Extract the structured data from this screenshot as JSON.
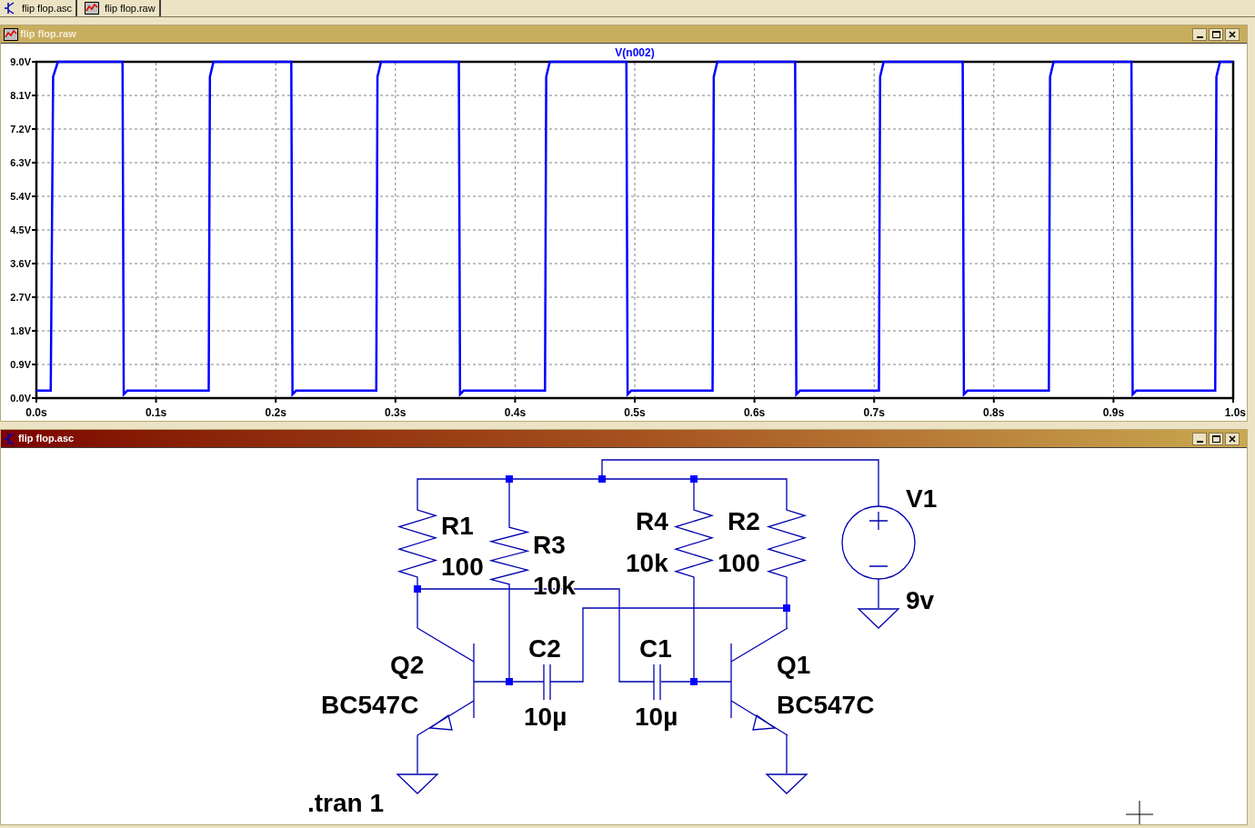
{
  "tabs": [
    {
      "label": "flip flop.asc",
      "kind": "schematic"
    },
    {
      "label": "flip flop.raw",
      "kind": "waveform"
    }
  ],
  "windows": [
    {
      "kind": "waveform",
      "title": "flip flop.raw",
      "active": false,
      "plot": {
        "chart_data": {
          "type": "line",
          "grid": true,
          "xlim": [
            0,
            1
          ],
          "ylim": [
            0,
            9
          ],
          "xticks": [
            {
              "value": 0,
              "label": "0.0s"
            },
            {
              "value": 0.1,
              "label": "0.1s"
            },
            {
              "value": 0.2,
              "label": "0.2s"
            },
            {
              "value": 0.3,
              "label": "0.3s"
            },
            {
              "value": 0.4,
              "label": "0.4s"
            },
            {
              "value": 0.5,
              "label": "0.5s"
            },
            {
              "value": 0.6,
              "label": "0.6s"
            },
            {
              "value": 0.7,
              "label": "0.7s"
            },
            {
              "value": 0.8,
              "label": "0.8s"
            },
            {
              "value": 0.9,
              "label": "0.9s"
            },
            {
              "value": 1,
              "label": "1.0s"
            }
          ],
          "yticks": [
            {
              "value": 9,
              "label": "9.0V"
            },
            {
              "value": 8.1,
              "label": "8.1V"
            },
            {
              "value": 7.2,
              "label": "7.2V"
            },
            {
              "value": 6.3,
              "label": "6.3V"
            },
            {
              "value": 5.4,
              "label": "5.4V"
            },
            {
              "value": 4.5,
              "label": "4.5V"
            },
            {
              "value": 3.6,
              "label": "3.6V"
            },
            {
              "value": 2.7,
              "label": "2.7V"
            },
            {
              "value": 1.8,
              "label": "1.8V"
            },
            {
              "value": 0.9,
              "label": "0.9V"
            },
            {
              "value": 0,
              "label": "0.0V"
            }
          ],
          "x": [
            0,
            0.012,
            0.014,
            0.018,
            0.072,
            0.073,
            0.076,
            0.144,
            0.145,
            0.148,
            0.213,
            0.214,
            0.217,
            0.284,
            0.285,
            0.288,
            0.353,
            0.354,
            0.357,
            0.425,
            0.426,
            0.429,
            0.493,
            0.494,
            0.497,
            0.565,
            0.566,
            0.569,
            0.634,
            0.635,
            0.638,
            0.704,
            0.705,
            0.708,
            0.774,
            0.775,
            0.778,
            0.846,
            0.847,
            0.85,
            0.915,
            0.916,
            0.919,
            0.985,
            0.986,
            0.989,
            1.0
          ],
          "series": [
            {
              "name": "V(n002)",
              "color": "#0000ff",
              "values": [
                0.2,
                0.2,
                8.6,
                9,
                9,
                0.1,
                0.2,
                0.2,
                8.6,
                9,
                9,
                0.1,
                0.2,
                0.2,
                8.6,
                9,
                9,
                0.1,
                0.2,
                0.2,
                8.6,
                9,
                9,
                0.1,
                0.2,
                0.2,
                8.6,
                9,
                9,
                0.1,
                0.2,
                0.2,
                8.6,
                9,
                9,
                0.1,
                0.2,
                0.2,
                8.6,
                9,
                9,
                0.1,
                0.2,
                0.2,
                8.6,
                9,
                9
              ]
            }
          ]
        }
      }
    },
    {
      "kind": "schematic",
      "title": "flip flop.asc",
      "active": true,
      "schematic": {
        "components": [
          {
            "kind": "resistor",
            "name": "R1",
            "value": "100"
          },
          {
            "kind": "resistor",
            "name": "R3",
            "value": "10k"
          },
          {
            "kind": "resistor",
            "name": "R4",
            "value": "10k"
          },
          {
            "kind": "resistor",
            "name": "R2",
            "value": "100"
          },
          {
            "kind": "source",
            "name": "V1",
            "value": "9v"
          },
          {
            "kind": "npn",
            "name": "Q2",
            "value": "BC547C"
          },
          {
            "kind": "capacitor",
            "name": "C2",
            "value": "10µ"
          },
          {
            "kind": "capacitor",
            "name": "C1",
            "value": "10µ"
          },
          {
            "kind": "npn",
            "name": "Q1",
            "value": "BC547C"
          }
        ],
        "directive": ".tran 1"
      }
    }
  ]
}
